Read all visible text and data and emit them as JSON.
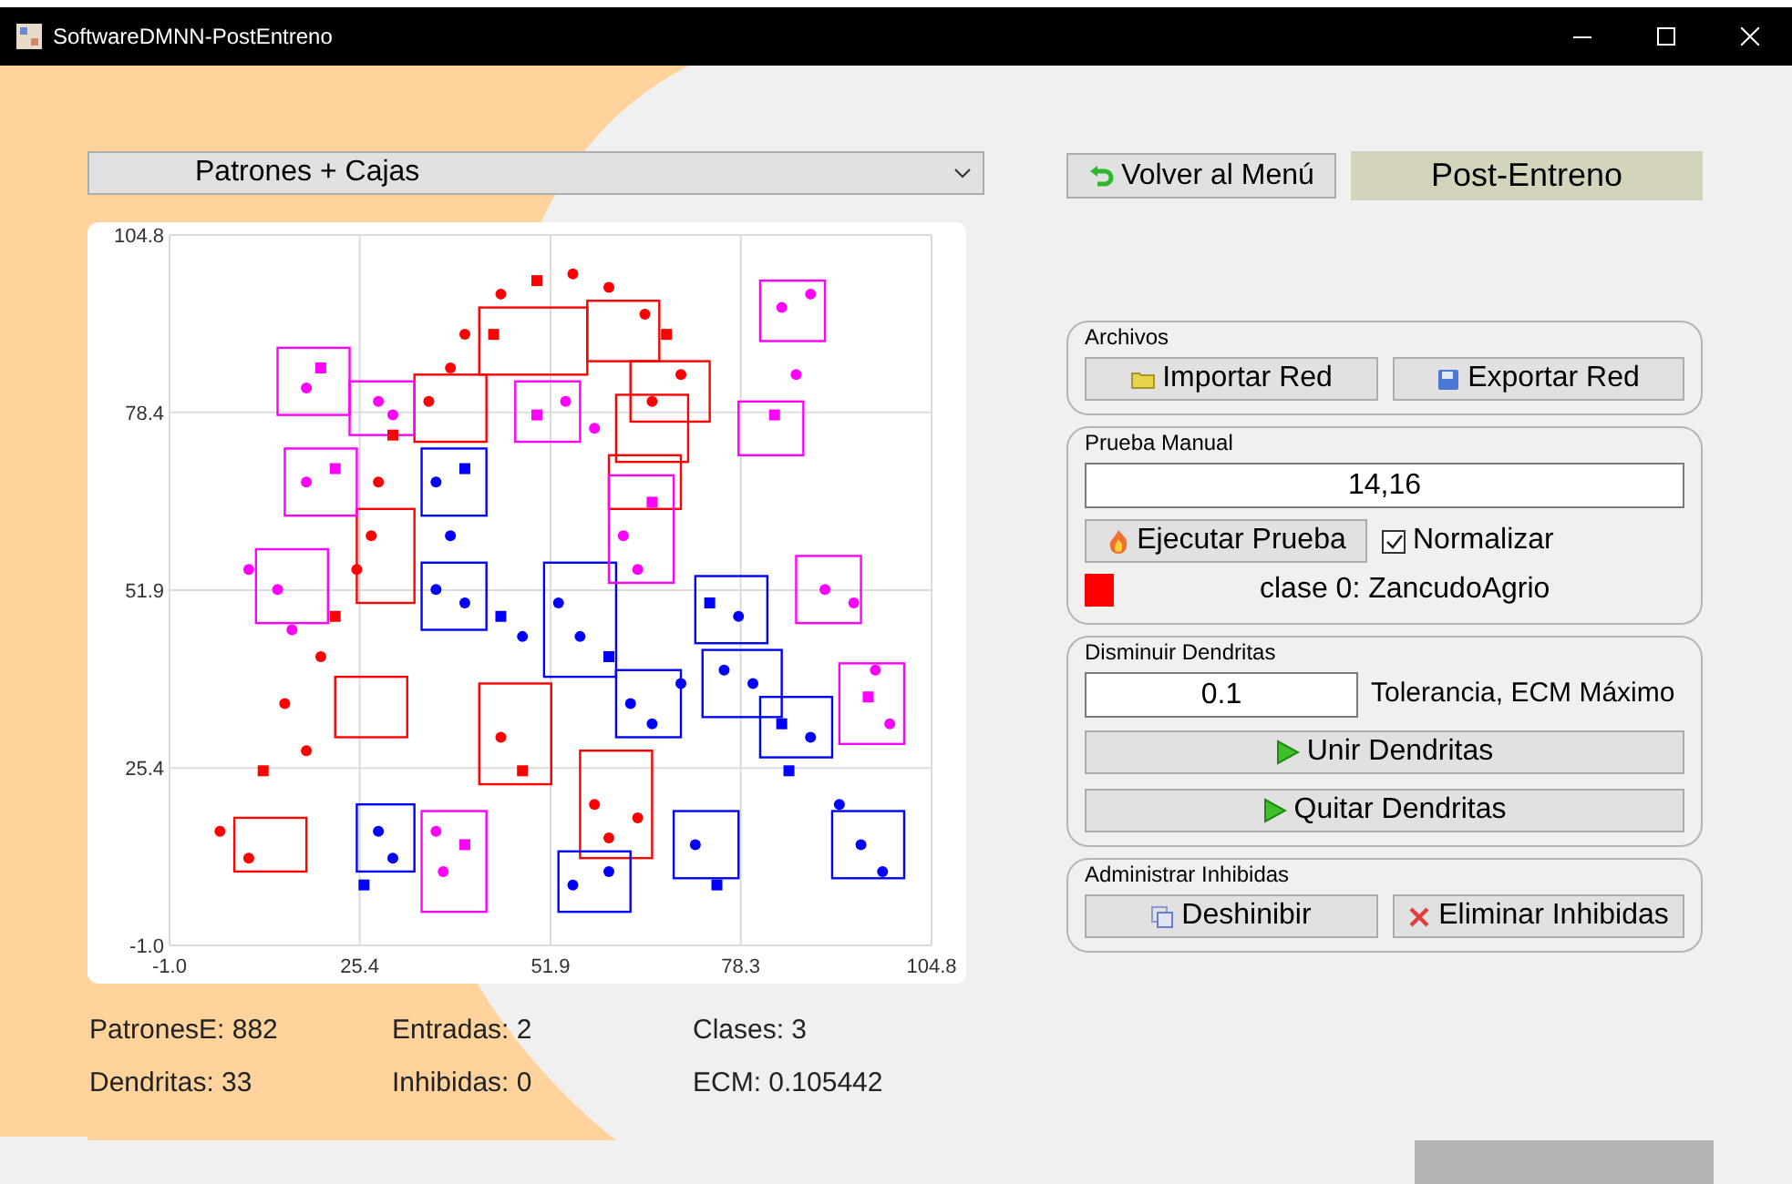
{
  "window": {
    "title": "SoftwareDMNN-PostEntreno"
  },
  "view_select": {
    "value": "Patrones + Cajas"
  },
  "plot": {
    "chart_data": {
      "type": "scatter",
      "grid": true,
      "xlim": [
        -1,
        104.8
      ],
      "ylim": [
        -1,
        104.8
      ],
      "x": [
        45,
        50,
        55,
        60,
        65,
        68,
        40,
        38,
        35,
        30,
        28,
        27,
        25,
        22,
        20,
        15,
        18,
        12,
        6,
        10,
        45,
        48,
        58,
        64,
        60,
        44,
        70,
        66,
        36,
        40,
        38,
        36,
        40,
        45,
        48,
        53,
        56,
        60,
        63,
        66,
        70,
        74,
        78,
        76,
        80,
        84,
        88,
        28,
        30,
        26,
        55,
        60,
        72,
        75,
        95,
        98,
        92,
        85,
        18,
        20,
        28,
        30,
        18,
        22,
        14,
        10,
        16,
        50,
        54,
        58,
        62,
        66,
        64,
        84,
        88,
        83,
        86,
        90,
        94,
        96,
        99,
        97,
        37,
        40,
        36
      ],
      "xticks": [
        {
          "value": -1,
          "label": "-1.0"
        },
        25.4,
        51.9,
        78.3,
        104.8
      ],
      "yticks": [
        {
          "value": -1,
          "label": "-1.0"
        },
        25.4,
        51.9,
        78.4,
        104.8
      ],
      "series": [
        {
          "color": "#ff0000",
          "values": [
            96,
            98,
            99,
            97,
            93,
            90,
            90,
            85,
            80,
            75,
            68,
            60,
            55,
            48,
            42,
            35,
            28,
            25,
            16,
            12,
            30,
            25,
            20,
            18,
            15,
            90,
            84,
            80,
            null,
            null,
            null,
            null,
            null,
            null,
            null,
            null,
            null,
            null,
            null,
            null,
            null,
            null,
            null,
            null,
            null,
            null,
            null,
            null,
            null,
            null,
            null,
            null,
            null,
            null,
            null,
            null,
            null,
            null,
            null,
            null,
            null,
            null,
            null,
            null,
            null,
            null,
            null,
            null,
            null,
            null,
            null,
            null,
            null,
            null,
            null,
            null,
            null,
            null,
            null,
            null,
            null,
            null,
            null,
            null,
            null
          ]
        },
        {
          "color": "#0000ff",
          "values": [
            null,
            null,
            null,
            null,
            null,
            null,
            null,
            null,
            null,
            null,
            null,
            null,
            null,
            null,
            null,
            null,
            null,
            null,
            null,
            null,
            null,
            null,
            null,
            null,
            null,
            null,
            null,
            null,
            68,
            70,
            60,
            52,
            50,
            48,
            45,
            50,
            45,
            42,
            35,
            32,
            38,
            50,
            48,
            40,
            38,
            32,
            30,
            16,
            12,
            8,
            8,
            10,
            14,
            8,
            14,
            10,
            20,
            25,
            null,
            null,
            null,
            null,
            null,
            null,
            null,
            null,
            null,
            null,
            null,
            null,
            null,
            null,
            null,
            null,
            null,
            null,
            null,
            null,
            null,
            null,
            null,
            null,
            null,
            null,
            null
          ]
        },
        {
          "color": "#ff00ff",
          "values": [
            null,
            null,
            null,
            null,
            null,
            null,
            null,
            null,
            null,
            null,
            null,
            null,
            null,
            null,
            null,
            null,
            null,
            null,
            null,
            null,
            null,
            null,
            null,
            null,
            null,
            null,
            null,
            null,
            null,
            null,
            null,
            null,
            null,
            null,
            null,
            null,
            null,
            null,
            null,
            null,
            null,
            null,
            null,
            null,
            null,
            null,
            null,
            null,
            null,
            null,
            null,
            null,
            null,
            null,
            null,
            null,
            null,
            null,
            82,
            85,
            80,
            78,
            68,
            70,
            52,
            55,
            46,
            78,
            80,
            76,
            60,
            65,
            55,
            94,
            96,
            78,
            84,
            52,
            50,
            36,
            32,
            40,
            10,
            14,
            16
          ]
        }
      ]
    }
  },
  "stats": [
    "PatronesE: 882",
    "Entradas: 2",
    "Clases: 3",
    "Dendritas: 33",
    "Inhibidas: 0",
    "ECM: 0.105442"
  ],
  "back_button": {
    "label": "Volver al Menú"
  },
  "mode_label": "Post-Entreno",
  "archivos": {
    "title": "Archivos",
    "buttons": [
      {
        "label": "Importar Red",
        "kind": "folder"
      },
      {
        "label": "Exportar Red",
        "kind": "save"
      }
    ]
  },
  "prueba_manual": {
    "title": "Prueba Manual",
    "input": "14,16",
    "run_button": "Ejecutar Prueba",
    "normalize": {
      "label": "Normalizar",
      "checked": true
    },
    "result": {
      "color": "#ff0000",
      "text": "clase 0: ZancudoAgrio"
    }
  },
  "disminuir": {
    "title": "Disminuir Dendritas",
    "tolerance": "0.1",
    "tolerance_label": "Tolerancia, ECM Máximo",
    "buttons": [
      "Unir Dendritas",
      "Quitar Dendritas"
    ]
  },
  "inhibidas": {
    "title": "Administrar Inhibidas",
    "buttons": [
      {
        "label": "Deshinibir",
        "kind": "restore"
      },
      {
        "label": "Eliminar Inhibidas",
        "kind": "delete"
      }
    ]
  }
}
